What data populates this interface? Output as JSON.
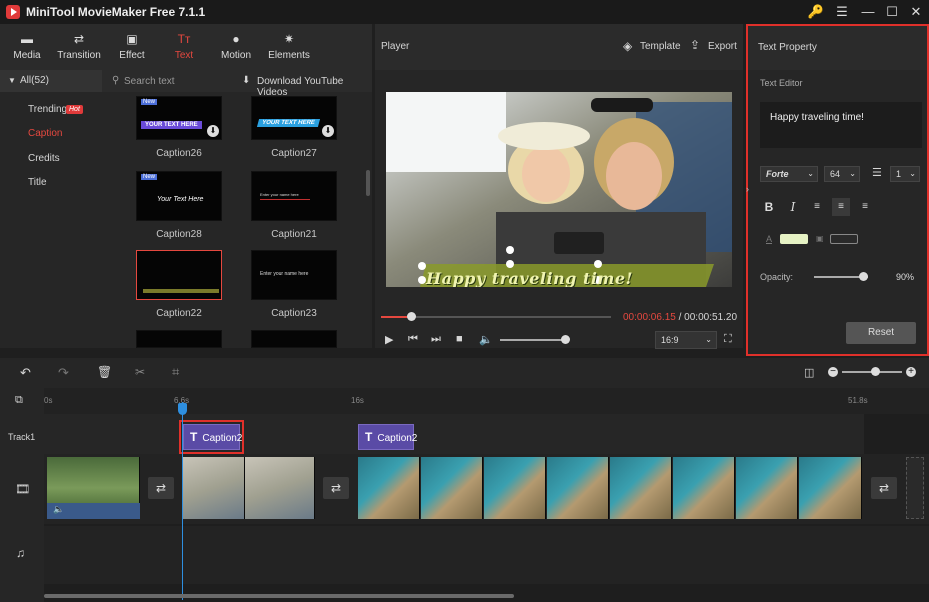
{
  "app": {
    "title": "MiniTool MovieMaker Free 7.1.1"
  },
  "window_controls": {
    "key": "🔑",
    "menu": "☰",
    "minimize": "—",
    "maximize": "☐",
    "close": "✕"
  },
  "media_tabs": [
    {
      "label": "Media",
      "icon": "folder-icon",
      "glyph": "▬"
    },
    {
      "label": "Transition",
      "icon": "transition-icon",
      "glyph": "⇄"
    },
    {
      "label": "Effect",
      "icon": "effect-icon",
      "glyph": "▣"
    },
    {
      "label": "Text",
      "icon": "text-icon",
      "glyph": "Tт"
    },
    {
      "label": "Motion",
      "icon": "motion-icon",
      "glyph": "●"
    },
    {
      "label": "Elements",
      "icon": "elements-icon",
      "glyph": "✷"
    }
  ],
  "active_tab": "Text",
  "accent_color": "#e5483f",
  "categories": {
    "all": "All(52)",
    "items": [
      "Trending",
      "Caption",
      "Credits",
      "Title"
    ],
    "hot_badge": "Hot",
    "active": "Caption"
  },
  "search": {
    "placeholder": "Search text",
    "download": "Download YouTube Videos"
  },
  "templates": [
    {
      "name": "Caption26",
      "text": "YOUR TEXT HERE"
    },
    {
      "name": "Caption27",
      "text": "YOUR TEXT HERE"
    },
    {
      "name": "Caption28",
      "text": "Your Text Here"
    },
    {
      "name": "Caption21",
      "text": "Enter your name here"
    },
    {
      "name": "Caption22",
      "text": ""
    },
    {
      "name": "Caption23",
      "text": "Enter your name here"
    }
  ],
  "new_badge": "New",
  "player": {
    "title": "Player",
    "template_btn": "Template",
    "export_btn": "Export",
    "caption_text": "Happy traveling time!",
    "current_time": "00:00:06.15",
    "separator": " / ",
    "total_time": "00:00:51.20",
    "aspect_ratio": "16:9",
    "progress": 0.13,
    "volume": 0.6
  },
  "text_property": {
    "title": "Text Property",
    "editor_label": "Text Editor",
    "editor_text": "Happy traveling time!",
    "font": "Forte",
    "size": "64",
    "line_spacing": "1",
    "opacity_label": "Opacity:",
    "opacity_value": "90%",
    "opacity": 0.9,
    "text_color": "#e6f2c4",
    "bg_color": "#2a2a2a",
    "reset": "Reset"
  },
  "timeline": {
    "ruler": [
      "0s",
      "6.6s",
      "16s",
      "51.8s"
    ],
    "track1": "Track1",
    "caption_clips": [
      "Caption2",
      "Caption2"
    ],
    "zoom": 0.55
  }
}
